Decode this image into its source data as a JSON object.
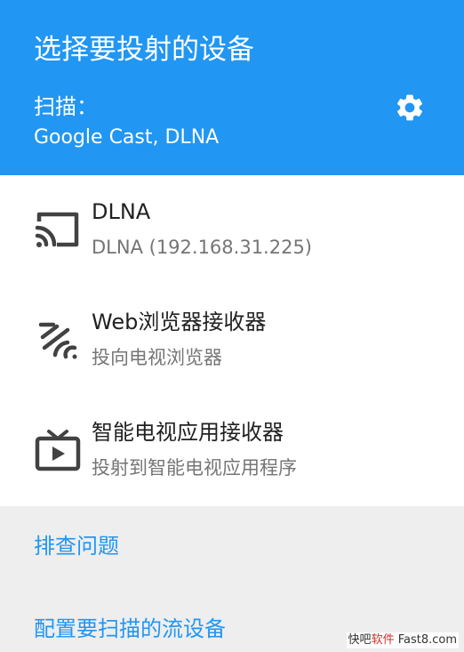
{
  "header": {
    "title": "选择要投射的设备",
    "scan_label": "扫描：",
    "scan_value": "Google Cast, DLNA",
    "settings_icon": "gear-icon"
  },
  "devices": [
    {
      "name": "DLNA",
      "desc": "DLNA (192.168.31.225)",
      "icon": "cast-icon"
    },
    {
      "name": "Web浏览器接收器",
      "desc": "投向电视浏览器",
      "icon": "wireless-signal-icon"
    },
    {
      "name": "智能电视应用接收器",
      "desc": "投射到智能电视应用程序",
      "icon": "tv-play-icon"
    }
  ],
  "footer": {
    "troubleshoot": "排查问题",
    "configure": "配置要扫描的流设备"
  },
  "watermark": {
    "prefix": "快吧",
    "brand": "软件",
    "suffix": " Fast8.com"
  },
  "colors": {
    "header_bg": "#2196f3",
    "link": "#2196f3",
    "footer_bg": "#eeeeee",
    "icon": "#424242"
  }
}
